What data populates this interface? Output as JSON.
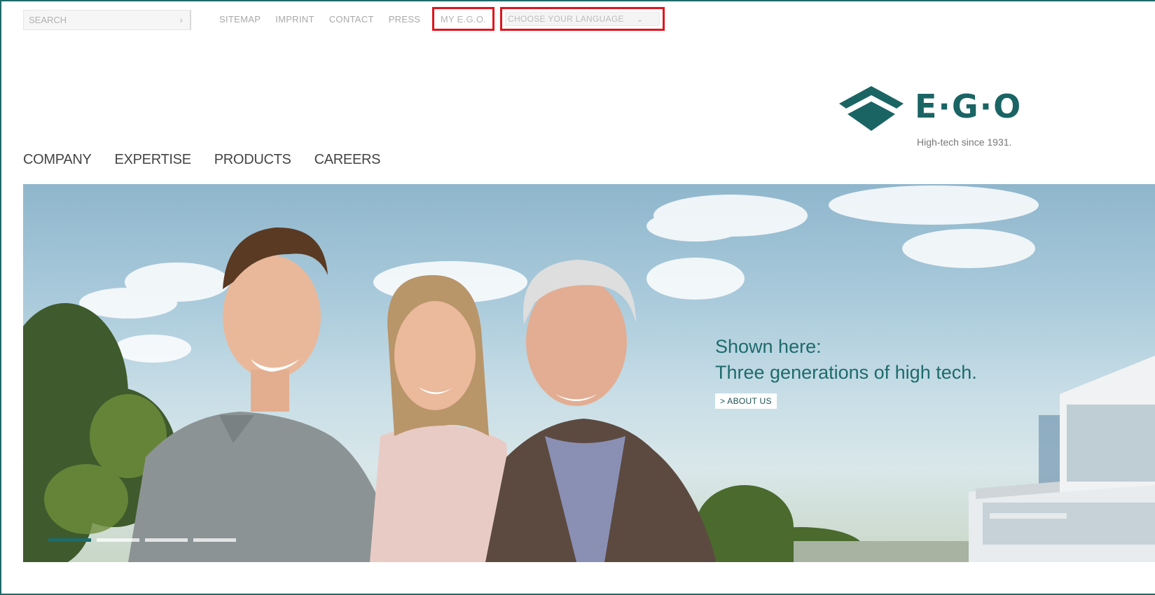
{
  "search": {
    "placeholder": "SEARCH",
    "go_icon": "›"
  },
  "utility_links": [
    {
      "label": "SITEMAP"
    },
    {
      "label": "IMPRINT"
    },
    {
      "label": "CONTACT"
    },
    {
      "label": "PRESS"
    }
  ],
  "my_ego": {
    "label": "MY E.G.O."
  },
  "language": {
    "selected": "CHOOSE YOUR LANGUAGE",
    "chevron": "⌄"
  },
  "logo": {
    "text": "E·G·O",
    "tagline": "High-tech since 1931."
  },
  "main_nav": [
    {
      "label": "COMPANY"
    },
    {
      "label": "EXPERTISE"
    },
    {
      "label": "PRODUCTS"
    },
    {
      "label": "CAREERS"
    }
  ],
  "hero": {
    "line1": "Shown here:",
    "line2": "Three generations of high tech.",
    "cta": "> ABOUT US",
    "slides_total": 4,
    "slide_active": 1
  },
  "colors": {
    "brand_teal": "#1a6464",
    "highlight_red": "#e0141e"
  }
}
